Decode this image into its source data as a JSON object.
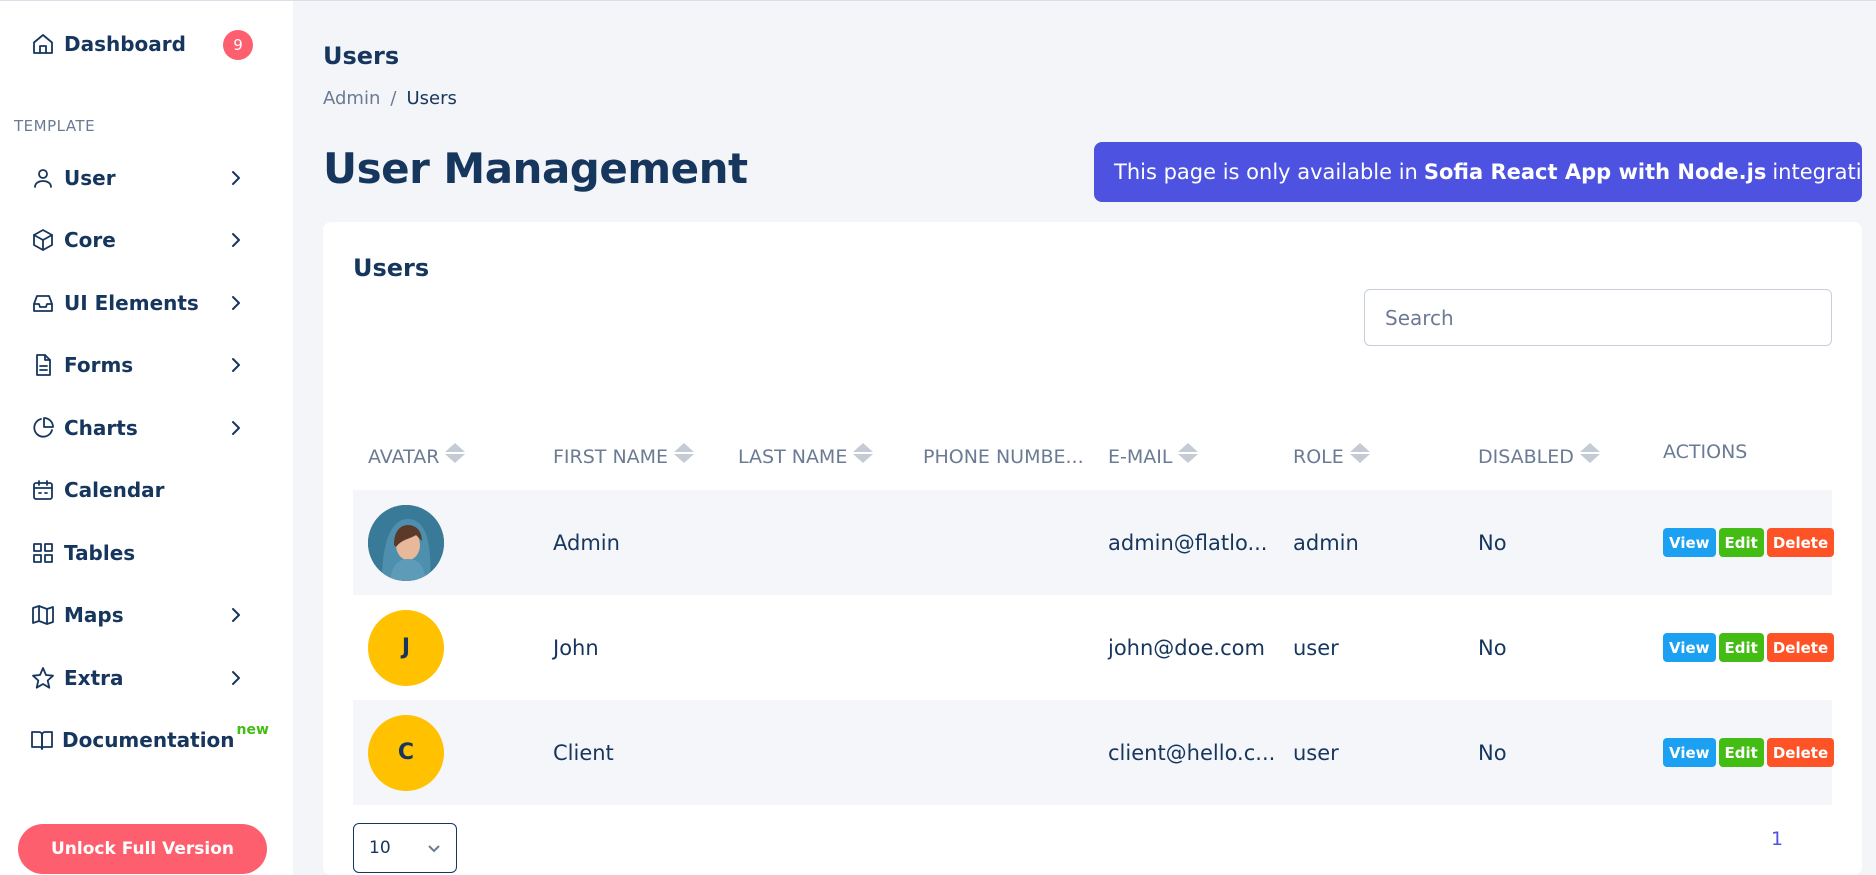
{
  "sidebar": {
    "dashboard": {
      "label": "Dashboard",
      "badge": "9",
      "icon": "home-icon"
    },
    "section_label": "TEMPLATE",
    "items": [
      {
        "label": "User",
        "icon": "user-icon"
      },
      {
        "label": "Core",
        "icon": "box-icon"
      },
      {
        "label": "UI Elements",
        "icon": "inbox-icon"
      },
      {
        "label": "Forms",
        "icon": "file-text-icon"
      },
      {
        "label": "Charts",
        "icon": "pie-chart-icon"
      },
      {
        "label": "Calendar",
        "icon": "calendar-icon"
      },
      {
        "label": "Tables",
        "icon": "grid-icon"
      },
      {
        "label": "Maps",
        "icon": "map-icon"
      },
      {
        "label": "Extra",
        "icon": "star-icon"
      },
      {
        "label": "Documentation",
        "icon": "book-icon",
        "tag": "new"
      }
    ],
    "unlock_label": "Unlock Full Version"
  },
  "header": {
    "title": "Users",
    "breadcrumb": {
      "parent": "Admin",
      "separator": "/",
      "current": "Users"
    }
  },
  "main": {
    "page_title": "User Management",
    "banner": {
      "prefix": "This page is only available in",
      "bold": "Sofia React App with Node.js",
      "suffix": "integration!"
    }
  },
  "table_card": {
    "title": "Users",
    "search_placeholder": "Search",
    "columns": [
      "AVATAR",
      "FIRST NAME",
      "LAST NAME",
      "PHONE NUMBE...",
      "E-MAIL",
      "ROLE",
      "DISABLED",
      "ACTIONS"
    ],
    "rows": [
      {
        "avatar": "",
        "first_name": "Admin",
        "last_name": "",
        "phone": "",
        "email": "admin@flatlo...",
        "role": "admin",
        "disabled": "No"
      },
      {
        "avatar": "J",
        "first_name": "John",
        "last_name": "",
        "phone": "",
        "email": "john@doe.com",
        "role": "user",
        "disabled": "No"
      },
      {
        "avatar": "C",
        "first_name": "Client",
        "last_name": "",
        "phone": "",
        "email": "client@hello.c...",
        "role": "user",
        "disabled": "No"
      }
    ],
    "actions": {
      "view": "View",
      "edit": "Edit",
      "delete": "Delete"
    },
    "page_size": "10",
    "current_page": "1"
  },
  "colors": {
    "accent": "#4d53e0",
    "danger": "#fd5f6e",
    "view": "#1ba0f2",
    "edit": "#43bc13",
    "delete": "#fd5326",
    "avatar_letter_bg": "#ffc100"
  }
}
